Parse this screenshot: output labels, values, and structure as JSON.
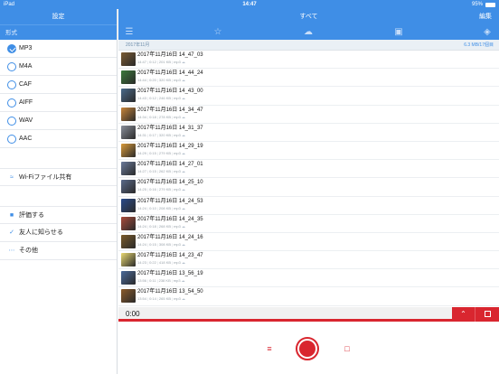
{
  "statusbar": {
    "device": "iPad",
    "time": "14:47",
    "battery": "95%",
    "battery_level": 0.95
  },
  "sidebar": {
    "title": "設定",
    "section_label": "形式",
    "formats": [
      {
        "label": "MP3",
        "selected": true
      },
      {
        "label": "M4A",
        "selected": false
      },
      {
        "label": "CAF",
        "selected": false
      },
      {
        "label": "AIFF",
        "selected": false
      },
      {
        "label": "WAV",
        "selected": false
      },
      {
        "label": "AAC",
        "selected": false
      }
    ],
    "wifi_label": "Wi-Fiファイル共有",
    "items": [
      {
        "label": "評価する",
        "icon": "rate-icon"
      },
      {
        "label": "友人に知らせる",
        "icon": "share-icon"
      },
      {
        "label": "その他",
        "icon": "more-icon"
      }
    ]
  },
  "main": {
    "title": "すべて",
    "edit_label": "編集",
    "toolbar_icons": [
      "menu-icon",
      "star-icon",
      "cloud-icon",
      "lock-icon",
      "tag-icon"
    ],
    "list_header": {
      "month": "2017年11月",
      "storage": "6.3 MB/17個目"
    },
    "recordings": [
      {
        "title": "2017年11月16日 14_47_03",
        "time": "14:47",
        "duration": "0:12",
        "size": "201 KB",
        "format": "mp3",
        "thumb": "#7a5a32"
      },
      {
        "title": "2017年11月16日 14_44_24",
        "time": "14:44",
        "duration": "0:20",
        "size": "320 KB",
        "format": "mp3",
        "thumb": "#3a7a3a"
      },
      {
        "title": "2017年11月16日 14_43_00",
        "time": "14:43",
        "duration": "0:12",
        "size": "246 KB",
        "format": "mp3",
        "thumb": "#4a6a8a"
      },
      {
        "title": "2017年11月16日 14_34_47",
        "time": "14:34",
        "duration": "0:18",
        "size": "278 KB",
        "format": "mp3",
        "thumb": "#c8853a"
      },
      {
        "title": "2017年11月16日 14_31_37",
        "time": "14:31",
        "duration": "0:17",
        "size": "320 KB",
        "format": "mp3",
        "thumb": "#8a8f9a"
      },
      {
        "title": "2017年11月16日 14_29_19",
        "time": "14:29",
        "duration": "0:15",
        "size": "279 KB",
        "format": "mp3",
        "thumb": "#d89a3a"
      },
      {
        "title": "2017年11月16日 14_27_01",
        "time": "14:27",
        "duration": "0:15",
        "size": "262 KB",
        "format": "mp3",
        "thumb": "#6a7a9a"
      },
      {
        "title": "2017年11月16日 14_25_10",
        "time": "14:25",
        "duration": "0:16",
        "size": "279 KB",
        "format": "mp3",
        "thumb": "#5a6a8a"
      },
      {
        "title": "2017年11月16日 14_24_53",
        "time": "14:24",
        "duration": "0:10",
        "size": "208 KB",
        "format": "mp3",
        "thumb": "#2a4a8a"
      },
      {
        "title": "2017年11月16日 14_24_35",
        "time": "14:24",
        "duration": "0:18",
        "size": "268 KB",
        "format": "mp3",
        "thumb": "#a84a3a"
      },
      {
        "title": "2017年11月16日 14_24_16",
        "time": "14:24",
        "duration": "0:15",
        "size": "308 KB",
        "format": "mp3",
        "thumb": "#7a5a2a"
      },
      {
        "title": "2017年11月16日 14_23_47",
        "time": "14:23",
        "duration": "0:22",
        "size": "418 KB",
        "format": "mp3",
        "thumb": "#e8d870"
      },
      {
        "title": "2017年11月16日 13_56_19",
        "time": "13:56",
        "duration": "0:11",
        "size": "238 KB",
        "format": "mp3",
        "thumb": "#4a6a9a"
      },
      {
        "title": "2017年11月16日 13_54_50",
        "time": "13:54",
        "duration": "0:14",
        "size": "265 KB",
        "format": "mp3",
        "thumb": "#8a5a2a"
      }
    ]
  },
  "player": {
    "time": "0:00"
  },
  "colors": {
    "accent": "#3f8ee6",
    "record": "#d9262f"
  }
}
